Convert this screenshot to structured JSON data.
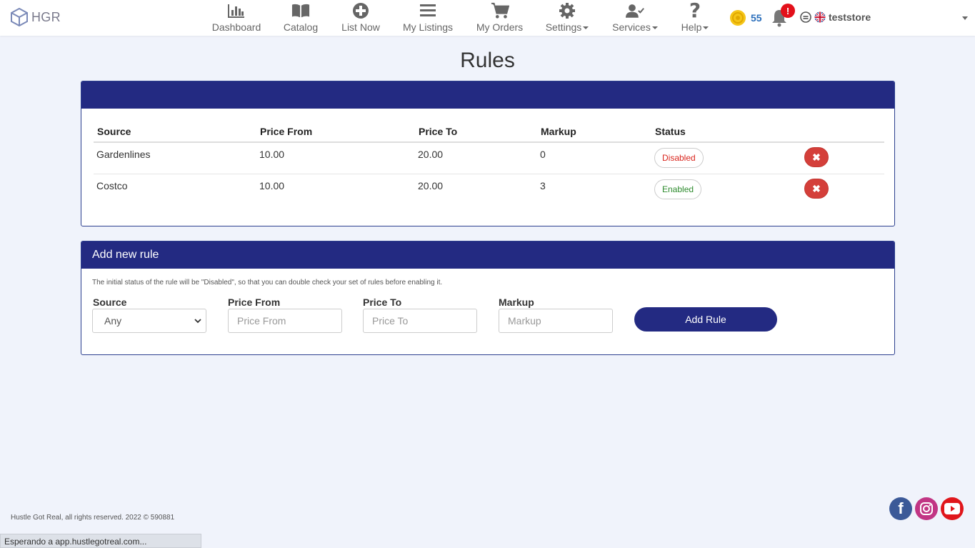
{
  "brand": {
    "name": "HGR"
  },
  "nav": {
    "items": [
      {
        "label": "Dashboard",
        "icon": "bar-chart-icon"
      },
      {
        "label": "Catalog",
        "icon": "book-icon"
      },
      {
        "label": "List Now",
        "icon": "plus-circle-icon"
      },
      {
        "label": "My Listings",
        "icon": "list-icon"
      },
      {
        "label": "My Orders",
        "icon": "cart-icon"
      },
      {
        "label": "Settings",
        "icon": "gear-icon"
      },
      {
        "label": "Services",
        "icon": "user-check-icon"
      },
      {
        "label": "Help",
        "icon": "question-icon"
      }
    ]
  },
  "account": {
    "coins": "55",
    "notifications_badge": "!",
    "username": "teststore"
  },
  "page": {
    "title": "Rules"
  },
  "rules_panel": {
    "columns": [
      "Source",
      "Price From",
      "Price To",
      "Markup",
      "Status"
    ],
    "rows": [
      {
        "source": "Gardenlines",
        "price_from": "10.00",
        "price_to": "20.00",
        "markup": "0",
        "status": "Disabled"
      },
      {
        "source": "Costco",
        "price_from": "10.00",
        "price_to": "20.00",
        "markup": "3",
        "status": "Enabled"
      }
    ]
  },
  "add_panel": {
    "title": "Add new rule",
    "note": "The initial status of the rule will be \"Disabled\", so that you can double check your set of rules before enabling it.",
    "source_label": "Source",
    "source_value": "Any",
    "price_from_label": "Price From",
    "price_from_placeholder": "Price From",
    "price_to_label": "Price To",
    "price_to_placeholder": "Price To",
    "markup_label": "Markup",
    "markup_placeholder": "Markup",
    "add_button": "Add Rule"
  },
  "footer": {
    "text": "Hustle Got Real, all rights reserved. 2022 © 590881"
  },
  "browser_status": "Esperando a app.hustlegotreal.com...",
  "colors": {
    "primary": "#232a82",
    "danger": "#d43f3a",
    "coin": "#f5c518",
    "facebook": "#3b5998",
    "instagram": "#c13584",
    "youtube": "#e0161b"
  }
}
